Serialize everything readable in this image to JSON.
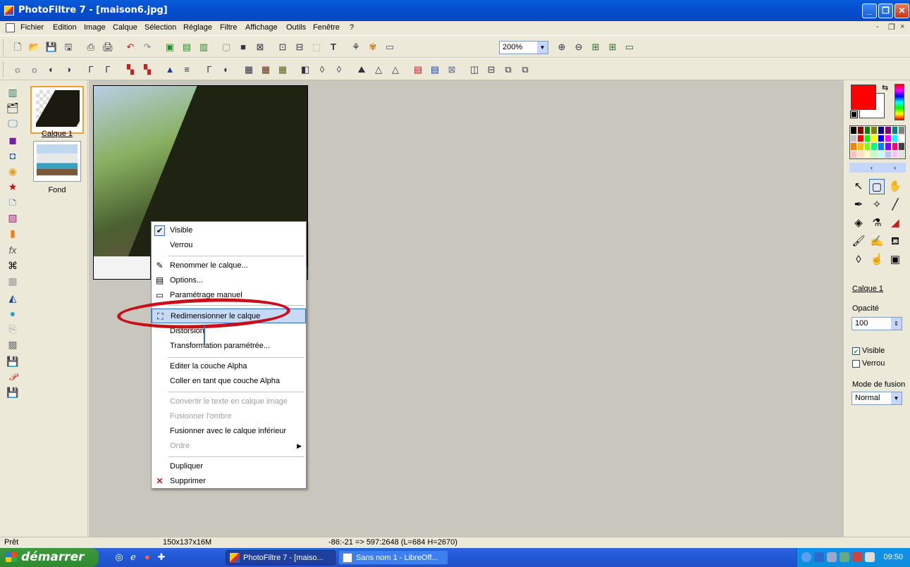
{
  "window": {
    "title": "PhotoFiltre 7 - [maison6.jpg]",
    "controls": [
      "_",
      "❐",
      "✕"
    ]
  },
  "menubar": {
    "items": [
      "Fichier",
      "Edition",
      "Image",
      "Calque",
      "Sélection",
      "Réglage",
      "Filtre",
      "Affichage",
      "Outils",
      "Fenêtre",
      "?"
    ],
    "mdi_controls": [
      "-",
      "❐",
      "×"
    ]
  },
  "toolbar": {
    "zoom": "200%"
  },
  "layers": {
    "items": [
      {
        "label": "Calque 1",
        "selected": true
      },
      {
        "label": "Fond",
        "selected": false
      }
    ]
  },
  "context_menu": {
    "items": [
      {
        "label": "Visible",
        "icon": "check-icon",
        "enabled": true,
        "checked": true
      },
      {
        "label": "Verrou",
        "enabled": true
      },
      {
        "label": "Renommer le calque...",
        "icon": "rename-icon",
        "enabled": true
      },
      {
        "label": "Options...",
        "icon": "options-icon",
        "enabled": true
      },
      {
        "label": "Paramétrage manuel",
        "icon": "manual-settings-icon",
        "enabled": true
      },
      {
        "label": "Redimensionner le calque",
        "icon": "resize-layer-icon",
        "enabled": true,
        "highlighted": true
      },
      {
        "label": "Distorsion",
        "enabled": true
      },
      {
        "label": "Transformation paramétrée...",
        "enabled": true
      },
      {
        "label": "Editer la couche Alpha",
        "enabled": true
      },
      {
        "label": "Coller en tant que couche Alpha",
        "enabled": true
      },
      {
        "label": "Convertir le texte en calque image",
        "enabled": false
      },
      {
        "label": "Fusionner l'ombre",
        "enabled": false
      },
      {
        "label": "Fusionner avec le calque inférieur",
        "enabled": true
      },
      {
        "label": "Ordre",
        "enabled": false,
        "submenu": true
      },
      {
        "label": "Dupliquer",
        "enabled": true
      },
      {
        "label": "Supprimer",
        "icon": "delete-icon",
        "enabled": true
      }
    ]
  },
  "right_panel": {
    "foreground_color": "#ff0000",
    "background_color": "#ffffff",
    "layer_name": "Calque 1",
    "opacity_label": "Opacité",
    "opacity_value": "100",
    "visible_label": "Visible",
    "visible_checked": true,
    "lock_label": "Verrou",
    "lock_checked": false,
    "blend_label": "Mode de fusion",
    "blend_value": "Normal"
  },
  "statusbar": {
    "state": "Prêt",
    "image_info": "150x137x16M",
    "coords": "-86:-21 => 597:2648 (L=684 H=2670)"
  },
  "taskbar": {
    "start_label": "démarrer",
    "tasks": [
      {
        "label": "PhotoFiltre 7 - [maiso...",
        "active": true
      },
      {
        "label": "Sans nom 1 - LibreOff...",
        "active": false
      }
    ],
    "clock": "09:50"
  }
}
